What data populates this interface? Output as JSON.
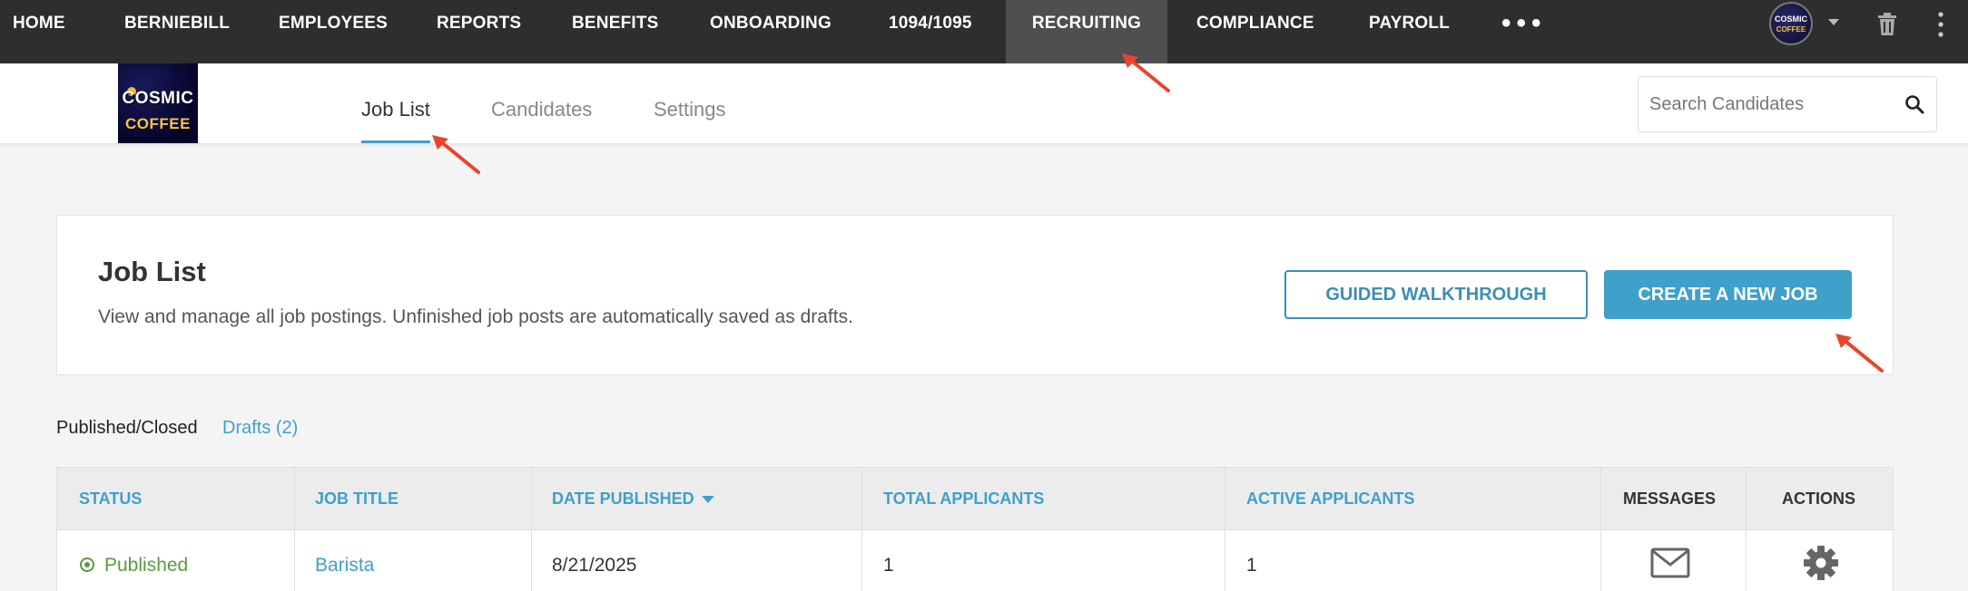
{
  "topnav": {
    "items": [
      {
        "label": "HOME",
        "active": false
      },
      {
        "label": "BERNIEBILL",
        "active": false
      },
      {
        "label": "EMPLOYEES",
        "active": false
      },
      {
        "label": "REPORTS",
        "active": false
      },
      {
        "label": "BENEFITS",
        "active": false
      },
      {
        "label": "ONBOARDING",
        "active": false
      },
      {
        "label": "1094/1095",
        "active": false
      },
      {
        "label": "RECRUITING",
        "active": true
      },
      {
        "label": "COMPLIANCE",
        "active": false
      },
      {
        "label": "PAYROLL",
        "active": false
      }
    ],
    "more_label": "•••",
    "avatar": {
      "line1": "COSMIC",
      "line2": "COFFEE"
    }
  },
  "logo": {
    "line1": "COSMIC",
    "line2": "COFFEE"
  },
  "subnav": {
    "tabs": [
      {
        "label": "Job List",
        "active": true
      },
      {
        "label": "Candidates",
        "active": false
      },
      {
        "label": "Settings",
        "active": false
      }
    ],
    "search_placeholder": "Search Candidates"
  },
  "header": {
    "title": "Job List",
    "description": "View and manage all job postings. Unfinished job posts are automatically saved as drafts.",
    "guided_label": "GUIDED WALKTHROUGH",
    "create_label": "CREATE A NEW JOB"
  },
  "filters": {
    "published_closed": "Published/Closed",
    "drafts": "Drafts (2)"
  },
  "table": {
    "headers": {
      "status": "STATUS",
      "job_title": "JOB TITLE",
      "date_published": "DATE PUBLISHED",
      "total_applicants": "TOTAL APPLICANTS",
      "active_applicants": "ACTIVE APPLICANTS",
      "messages": "MESSAGES",
      "actions": "ACTIONS"
    },
    "rows": [
      {
        "status": "Published",
        "job_title": "Barista",
        "date_published": "8/21/2025",
        "total_applicants": "1",
        "active_applicants": "1"
      }
    ]
  },
  "colors": {
    "accent": "#3fa0c9",
    "nav_bg": "#2e2e2e",
    "status_green": "#5a9a3e",
    "annotation": "#e8452c"
  },
  "icons": [
    "search-icon",
    "trash-icon",
    "kebab-icon",
    "mail-icon",
    "gear-icon",
    "status-published-icon",
    "chevron-down-icon"
  ]
}
